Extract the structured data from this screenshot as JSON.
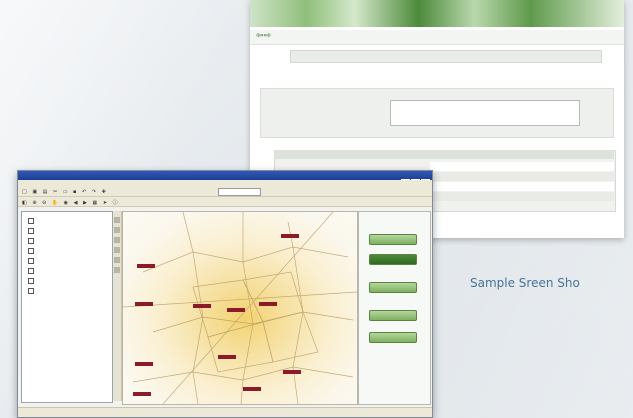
{
  "caption": "Sample Sreen Sho",
  "back_screen": {
    "nav_arrows": "⇦⇨",
    "menu_items": [
      "",
      "",
      "",
      ""
    ]
  },
  "front_screen": {
    "toc_items": [
      "",
      "",
      "",
      "",
      "",
      "",
      "",
      ""
    ],
    "panel_buttons": [
      "",
      "",
      "",
      "",
      ""
    ]
  },
  "colors": {
    "caption": "#4a7396",
    "map_label": "#8b1a2a",
    "panel_button": "#7fb162",
    "banner_green": "#4c8a3a"
  }
}
